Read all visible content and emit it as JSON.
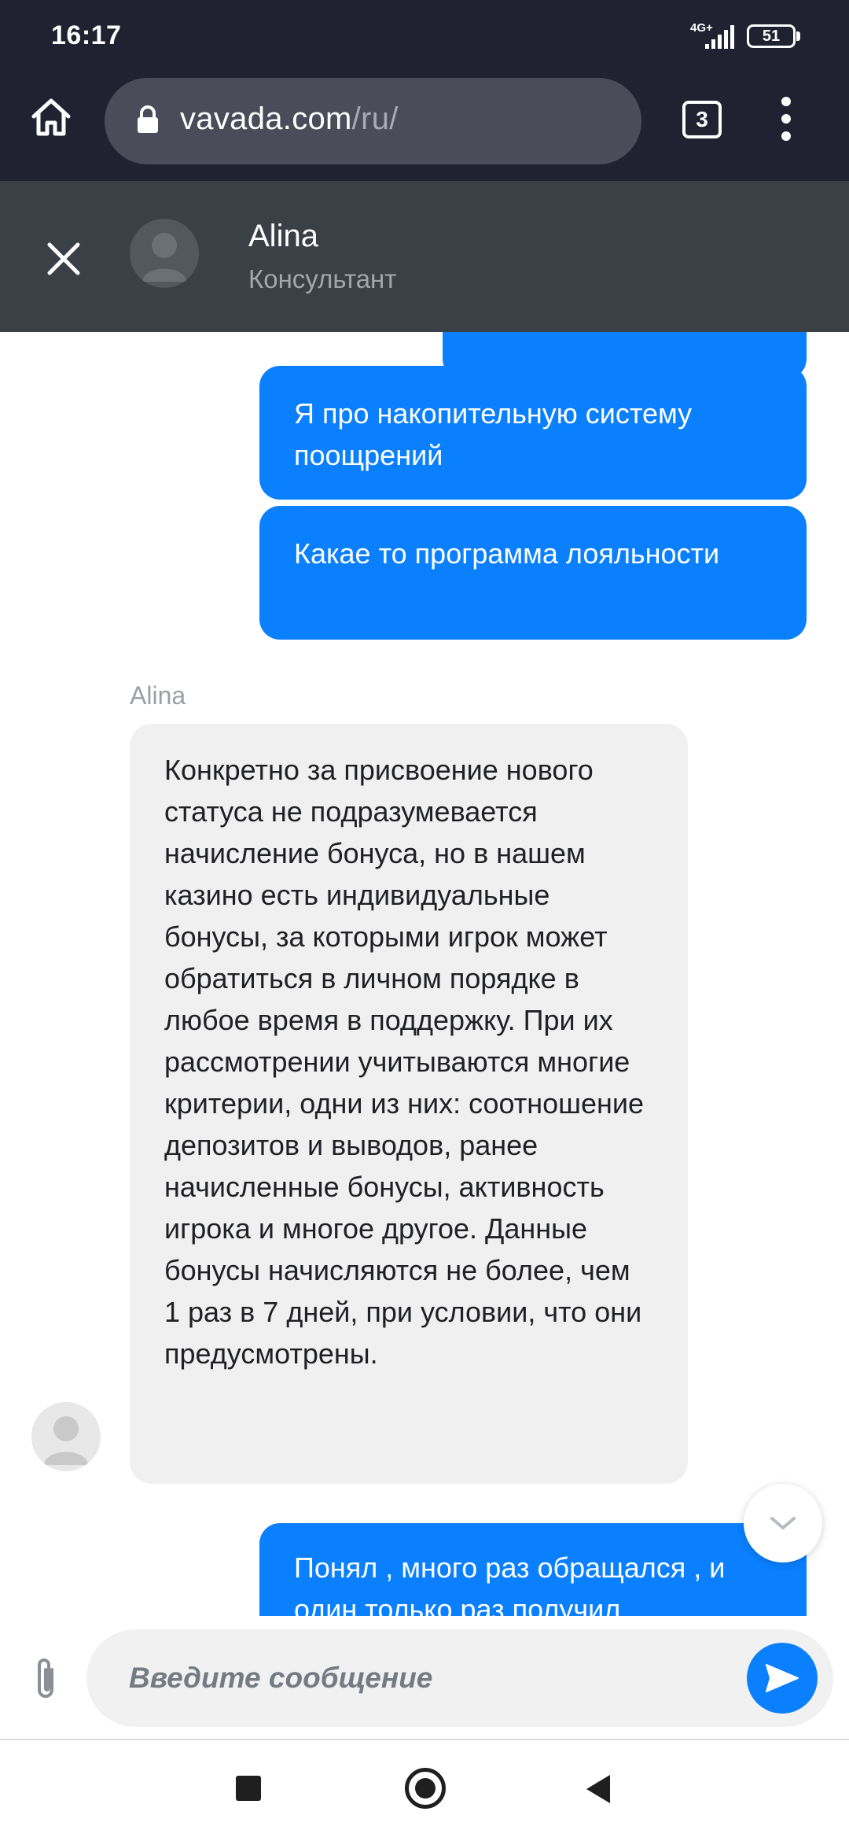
{
  "status_bar": {
    "time": "16:17",
    "network": "4G+",
    "battery": "51"
  },
  "browser": {
    "url_domain": "vavada.com",
    "url_path": "/ru/",
    "tab_count": "3"
  },
  "chat_header": {
    "agent_name": "Alina",
    "agent_role": "Консультант"
  },
  "messages": [
    {
      "from": "user",
      "text": ""
    },
    {
      "from": "user",
      "text": "Я про накопительную систему поощрений"
    },
    {
      "from": "user",
      "text": "Какае то программа лояльности"
    },
    {
      "from": "agent",
      "sender": "Alina",
      "text": "Конкретно за присвоение нового статуса не подразумевается начисление бонуса, но в нашем казино есть индивидуальные бонусы, за которыми игрок может обратиться в личном порядке в любое время в поддержку. При их рассмотрении учитываются многие критерии, одни из них: соотношение депозитов и выводов, ранее начисленные бонусы, активность игрока и многое другое. Данные бонусы начисляются не более, чем 1 раз в 7 дней, при условии, что они предусмотрены."
    },
    {
      "from": "user",
      "text": "Понял , много раз обращался , и один только раз получил"
    }
  ],
  "composer": {
    "placeholder": "Введите сообщение"
  },
  "colors": {
    "status_bar_bg": "#202231",
    "chat_header_bg": "#3b3f46",
    "outgoing_bubble": "#0a80ff",
    "incoming_bubble": "#f0f0f0",
    "send_button": "#0a80ff"
  },
  "icons": {
    "home": "home-icon",
    "lock": "lock-icon",
    "tabs": "tabs-icon",
    "menu": "more-vert-icon",
    "close": "close-icon",
    "attach": "paperclip-icon",
    "send": "send-icon",
    "scroll_down": "chevron-down-icon"
  }
}
